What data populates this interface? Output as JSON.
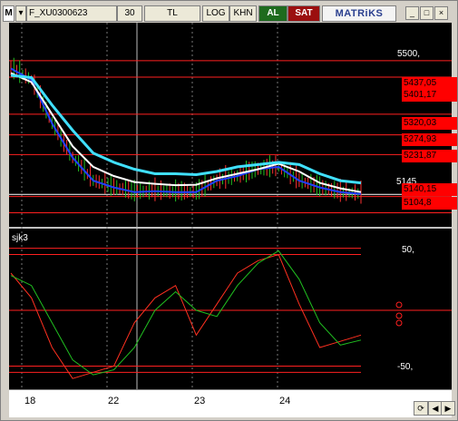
{
  "toolbar": {
    "logo": "M",
    "symbol": "F_XU0300623",
    "period": "30",
    "currency": "TL",
    "scale": "LOG",
    "khn": "KHN",
    "buy": "AL",
    "sell": "SAT",
    "brand": "MATRiKS"
  },
  "window_buttons": {
    "minimize": "_",
    "maximize": "□",
    "close": "×"
  },
  "price_axis": {
    "top_label": "5500,",
    "last_price": "5145,"
  },
  "levels": [
    "5437,05",
    "5401,17",
    "5320,03",
    "5274,93",
    "5231,87",
    "5140,15",
    "5104,8"
  ],
  "indicator": {
    "name": "sjk3",
    "top_label": "50,",
    "bottom_label": "-50,"
  },
  "x_axis": {
    "ticks": [
      "18",
      "22",
      "23",
      "24"
    ]
  },
  "colors": {
    "background": "#000000",
    "level_line": "#ff2020",
    "level_tag": "#ff0000",
    "ma_cyan": "#40e0ff",
    "ma_white": "#ffffff",
    "ma_blue": "#2040ff",
    "candle_green": "#20c020",
    "candle_red": "#ff3030",
    "stoch_red": "#ff3020",
    "stoch_green": "#20c020"
  },
  "chart_data": {
    "type": "line",
    "x": [
      "18",
      "22",
      "23",
      "24"
    ],
    "ylim": [
      5080,
      5520
    ],
    "horizontal_levels": [
      5437.05,
      5401.17,
      5320.03,
      5274.93,
      5231.87,
      5140.15,
      5104.8
    ],
    "last_price": 5145,
    "series": [
      {
        "values": [
          5420,
          5395,
          5300,
          5225,
          5175,
          5160,
          5150,
          5152,
          5150,
          5150,
          5175,
          5185,
          5200,
          5205,
          5175,
          5160,
          5150,
          5146
        ]
      },
      {
        "values": [
          5410,
          5390,
          5320,
          5250,
          5205,
          5185,
          5172,
          5168,
          5165,
          5166,
          5180,
          5190,
          5200,
          5212,
          5195,
          5170,
          5158,
          5150
        ]
      },
      {
        "values": [
          5405,
          5400,
          5340,
          5285,
          5235,
          5215,
          5200,
          5190,
          5190,
          5188,
          5195,
          5205,
          5210,
          5215,
          5210,
          5190,
          5175,
          5170
        ]
      }
    ],
    "indicator_ylim": [
      -60,
      60
    ],
    "indicator_series": [
      {
        "values": [
          30,
          10,
          -30,
          -55,
          -50,
          -45,
          -10,
          10,
          20,
          -20,
          5,
          30,
          40,
          45,
          5,
          -30,
          -25,
          -20
        ]
      },
      {
        "values": [
          28,
          20,
          -10,
          -40,
          -52,
          -48,
          -30,
          0,
          15,
          0,
          -5,
          20,
          38,
          48,
          25,
          -10,
          -28,
          -24
        ]
      }
    ]
  }
}
